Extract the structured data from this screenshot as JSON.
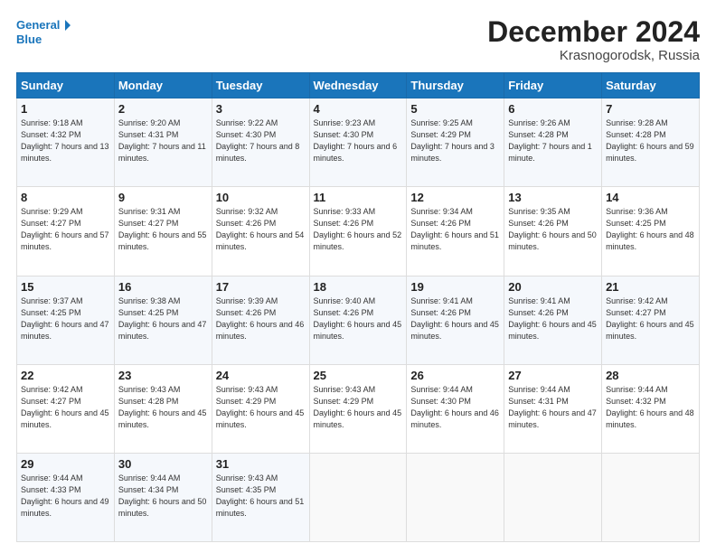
{
  "header": {
    "logo_line1": "General",
    "logo_line2": "Blue",
    "month_title": "December 2024",
    "location": "Krasnogorodsk, Russia"
  },
  "days_of_week": [
    "Sunday",
    "Monday",
    "Tuesday",
    "Wednesday",
    "Thursday",
    "Friday",
    "Saturday"
  ],
  "weeks": [
    [
      {
        "day": "1",
        "sunrise": "9:18 AM",
        "sunset": "4:32 PM",
        "daylight": "7 hours and 13 minutes."
      },
      {
        "day": "2",
        "sunrise": "9:20 AM",
        "sunset": "4:31 PM",
        "daylight": "7 hours and 11 minutes."
      },
      {
        "day": "3",
        "sunrise": "9:22 AM",
        "sunset": "4:30 PM",
        "daylight": "7 hours and 8 minutes."
      },
      {
        "day": "4",
        "sunrise": "9:23 AM",
        "sunset": "4:30 PM",
        "daylight": "7 hours and 6 minutes."
      },
      {
        "day": "5",
        "sunrise": "9:25 AM",
        "sunset": "4:29 PM",
        "daylight": "7 hours and 3 minutes."
      },
      {
        "day": "6",
        "sunrise": "9:26 AM",
        "sunset": "4:28 PM",
        "daylight": "7 hours and 1 minute."
      },
      {
        "day": "7",
        "sunrise": "9:28 AM",
        "sunset": "4:28 PM",
        "daylight": "6 hours and 59 minutes."
      }
    ],
    [
      {
        "day": "8",
        "sunrise": "9:29 AM",
        "sunset": "4:27 PM",
        "daylight": "6 hours and 57 minutes."
      },
      {
        "day": "9",
        "sunrise": "9:31 AM",
        "sunset": "4:27 PM",
        "daylight": "6 hours and 55 minutes."
      },
      {
        "day": "10",
        "sunrise": "9:32 AM",
        "sunset": "4:26 PM",
        "daylight": "6 hours and 54 minutes."
      },
      {
        "day": "11",
        "sunrise": "9:33 AM",
        "sunset": "4:26 PM",
        "daylight": "6 hours and 52 minutes."
      },
      {
        "day": "12",
        "sunrise": "9:34 AM",
        "sunset": "4:26 PM",
        "daylight": "6 hours and 51 minutes."
      },
      {
        "day": "13",
        "sunrise": "9:35 AM",
        "sunset": "4:26 PM",
        "daylight": "6 hours and 50 minutes."
      },
      {
        "day": "14",
        "sunrise": "9:36 AM",
        "sunset": "4:25 PM",
        "daylight": "6 hours and 48 minutes."
      }
    ],
    [
      {
        "day": "15",
        "sunrise": "9:37 AM",
        "sunset": "4:25 PM",
        "daylight": "6 hours and 47 minutes."
      },
      {
        "day": "16",
        "sunrise": "9:38 AM",
        "sunset": "4:25 PM",
        "daylight": "6 hours and 47 minutes."
      },
      {
        "day": "17",
        "sunrise": "9:39 AM",
        "sunset": "4:26 PM",
        "daylight": "6 hours and 46 minutes."
      },
      {
        "day": "18",
        "sunrise": "9:40 AM",
        "sunset": "4:26 PM",
        "daylight": "6 hours and 45 minutes."
      },
      {
        "day": "19",
        "sunrise": "9:41 AM",
        "sunset": "4:26 PM",
        "daylight": "6 hours and 45 minutes."
      },
      {
        "day": "20",
        "sunrise": "9:41 AM",
        "sunset": "4:26 PM",
        "daylight": "6 hours and 45 minutes."
      },
      {
        "day": "21",
        "sunrise": "9:42 AM",
        "sunset": "4:27 PM",
        "daylight": "6 hours and 45 minutes."
      }
    ],
    [
      {
        "day": "22",
        "sunrise": "9:42 AM",
        "sunset": "4:27 PM",
        "daylight": "6 hours and 45 minutes."
      },
      {
        "day": "23",
        "sunrise": "9:43 AM",
        "sunset": "4:28 PM",
        "daylight": "6 hours and 45 minutes."
      },
      {
        "day": "24",
        "sunrise": "9:43 AM",
        "sunset": "4:29 PM",
        "daylight": "6 hours and 45 minutes."
      },
      {
        "day": "25",
        "sunrise": "9:43 AM",
        "sunset": "4:29 PM",
        "daylight": "6 hours and 45 minutes."
      },
      {
        "day": "26",
        "sunrise": "9:44 AM",
        "sunset": "4:30 PM",
        "daylight": "6 hours and 46 minutes."
      },
      {
        "day": "27",
        "sunrise": "9:44 AM",
        "sunset": "4:31 PM",
        "daylight": "6 hours and 47 minutes."
      },
      {
        "day": "28",
        "sunrise": "9:44 AM",
        "sunset": "4:32 PM",
        "daylight": "6 hours and 48 minutes."
      }
    ],
    [
      {
        "day": "29",
        "sunrise": "9:44 AM",
        "sunset": "4:33 PM",
        "daylight": "6 hours and 49 minutes."
      },
      {
        "day": "30",
        "sunrise": "9:44 AM",
        "sunset": "4:34 PM",
        "daylight": "6 hours and 50 minutes."
      },
      {
        "day": "31",
        "sunrise": "9:43 AM",
        "sunset": "4:35 PM",
        "daylight": "6 hours and 51 minutes."
      },
      {
        "day": "",
        "sunrise": "",
        "sunset": "",
        "daylight": ""
      },
      {
        "day": "",
        "sunrise": "",
        "sunset": "",
        "daylight": ""
      },
      {
        "day": "",
        "sunrise": "",
        "sunset": "",
        "daylight": ""
      },
      {
        "day": "",
        "sunrise": "",
        "sunset": "",
        "daylight": ""
      }
    ]
  ]
}
